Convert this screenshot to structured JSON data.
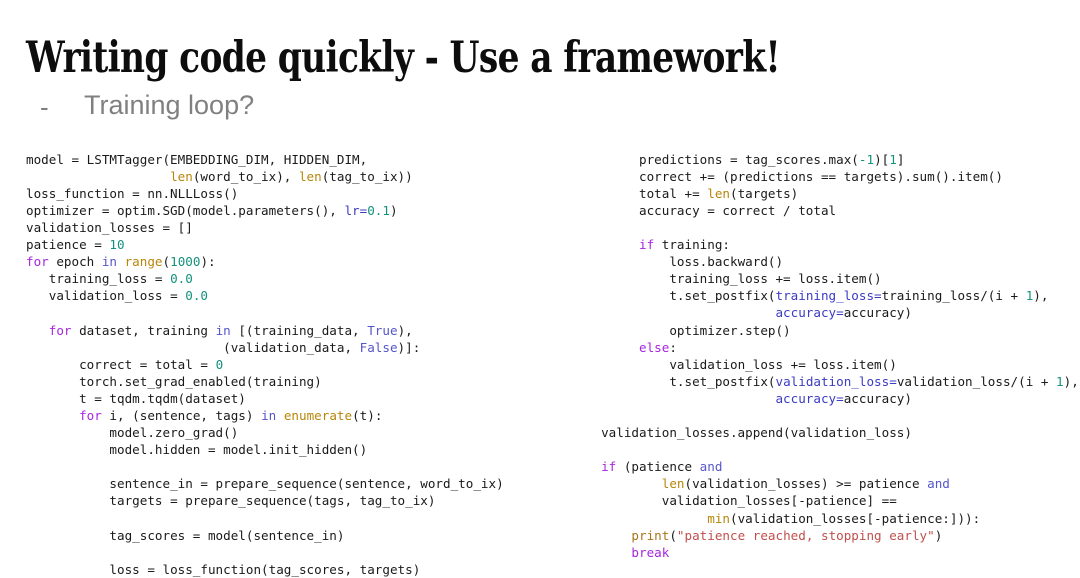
{
  "slide": {
    "title": "Writing code quickly - Use a framework!",
    "bullet_dash": "-",
    "bullet_text": "Training loop?",
    "background_color": "#ffffff",
    "title_color": "#0d0d0d",
    "bullet_color": "#808080"
  },
  "syntax_colors": {
    "keyword": "#a626e0",
    "operator_keyword": "#5555cc",
    "builtin": "#b8860b",
    "number": "#13917c",
    "kwarg": "#3b3bc4",
    "function": "#a8741a",
    "string": "#c0504d",
    "plain": "#1a1a1a"
  },
  "code_left": {
    "language": "python",
    "lines": [
      [
        {
          "t": "model = LSTMTagger(EMBEDDING_DIM, HIDDEN_DIM,",
          "c": "plain"
        }
      ],
      [
        {
          "t": "                   ",
          "c": "plain"
        },
        {
          "t": "len",
          "c": "builtin"
        },
        {
          "t": "(word_to_ix), ",
          "c": "plain"
        },
        {
          "t": "len",
          "c": "builtin"
        },
        {
          "t": "(tag_to_ix))",
          "c": "plain"
        }
      ],
      [
        {
          "t": "loss_function = nn.NLLLoss()",
          "c": "plain"
        }
      ],
      [
        {
          "t": "optimizer = optim.SGD(model.parameters(), ",
          "c": "plain"
        },
        {
          "t": "lr=",
          "c": "kwarg"
        },
        {
          "t": "0.1",
          "c": "number"
        },
        {
          "t": ")",
          "c": "plain"
        }
      ],
      [
        {
          "t": "validation_losses = []",
          "c": "plain"
        }
      ],
      [
        {
          "t": "patience = ",
          "c": "plain"
        },
        {
          "t": "10",
          "c": "number"
        }
      ],
      [
        {
          "t": "for",
          "c": "keyword"
        },
        {
          "t": " epoch ",
          "c": "plain"
        },
        {
          "t": "in",
          "c": "operator_keyword"
        },
        {
          "t": " ",
          "c": "plain"
        },
        {
          "t": "range",
          "c": "builtin"
        },
        {
          "t": "(",
          "c": "plain"
        },
        {
          "t": "1000",
          "c": "number"
        },
        {
          "t": "):",
          "c": "plain"
        }
      ],
      [
        {
          "t": "   training_loss = ",
          "c": "plain"
        },
        {
          "t": "0.0",
          "c": "number"
        }
      ],
      [
        {
          "t": "   validation_loss = ",
          "c": "plain"
        },
        {
          "t": "0.0",
          "c": "number"
        }
      ],
      [
        {
          "t": "",
          "c": "plain"
        }
      ],
      [
        {
          "t": "   ",
          "c": "plain"
        },
        {
          "t": "for",
          "c": "keyword"
        },
        {
          "t": " dataset, training ",
          "c": "plain"
        },
        {
          "t": "in",
          "c": "operator_keyword"
        },
        {
          "t": " [(training_data, ",
          "c": "plain"
        },
        {
          "t": "True",
          "c": "operator_keyword"
        },
        {
          "t": "),",
          "c": "plain"
        }
      ],
      [
        {
          "t": "                          (validation_data, ",
          "c": "plain"
        },
        {
          "t": "False",
          "c": "operator_keyword"
        },
        {
          "t": ")]:",
          "c": "plain"
        }
      ],
      [
        {
          "t": "       correct = total = ",
          "c": "plain"
        },
        {
          "t": "0",
          "c": "number"
        }
      ],
      [
        {
          "t": "       torch.set_grad_enabled(training)",
          "c": "plain"
        }
      ],
      [
        {
          "t": "       t = tqdm.tqdm(dataset)",
          "c": "plain"
        }
      ],
      [
        {
          "t": "       ",
          "c": "plain"
        },
        {
          "t": "for",
          "c": "keyword"
        },
        {
          "t": " i, (sentence, tags) ",
          "c": "plain"
        },
        {
          "t": "in",
          "c": "operator_keyword"
        },
        {
          "t": " ",
          "c": "plain"
        },
        {
          "t": "enumerate",
          "c": "builtin"
        },
        {
          "t": "(t):",
          "c": "plain"
        }
      ],
      [
        {
          "t": "           model.zero_grad()",
          "c": "plain"
        }
      ],
      [
        {
          "t": "           model.hidden = model.init_hidden()",
          "c": "plain"
        }
      ],
      [
        {
          "t": "",
          "c": "plain"
        }
      ],
      [
        {
          "t": "           sentence_in = prepare_sequence(sentence, word_to_ix)",
          "c": "plain"
        }
      ],
      [
        {
          "t": "           targets = prepare_sequence(tags, tag_to_ix)",
          "c": "plain"
        }
      ],
      [
        {
          "t": "",
          "c": "plain"
        }
      ],
      [
        {
          "t": "           tag_scores = model(sentence_in)",
          "c": "plain"
        }
      ],
      [
        {
          "t": "",
          "c": "plain"
        }
      ],
      [
        {
          "t": "           loss = loss_function(tag_scores, targets)",
          "c": "plain"
        }
      ]
    ]
  },
  "code_right": {
    "language": "python",
    "lines": [
      [
        {
          "t": "            predictions = tag_scores.max(",
          "c": "plain"
        },
        {
          "t": "-1",
          "c": "number"
        },
        {
          "t": ")[",
          "c": "plain"
        },
        {
          "t": "1",
          "c": "number"
        },
        {
          "t": "]",
          "c": "plain"
        }
      ],
      [
        {
          "t": "            correct += (predictions == targets).sum().item()",
          "c": "plain"
        }
      ],
      [
        {
          "t": "            total += ",
          "c": "plain"
        },
        {
          "t": "len",
          "c": "builtin"
        },
        {
          "t": "(targets)",
          "c": "plain"
        }
      ],
      [
        {
          "t": "            accuracy = correct / total",
          "c": "plain"
        }
      ],
      [
        {
          "t": "",
          "c": "plain"
        }
      ],
      [
        {
          "t": "            ",
          "c": "plain"
        },
        {
          "t": "if",
          "c": "keyword"
        },
        {
          "t": " training:",
          "c": "plain"
        }
      ],
      [
        {
          "t": "                loss.backward()",
          "c": "plain"
        }
      ],
      [
        {
          "t": "                training_loss += loss.item()",
          "c": "plain"
        }
      ],
      [
        {
          "t": "                t.set_postfix(",
          "c": "plain"
        },
        {
          "t": "training_loss=",
          "c": "kwarg"
        },
        {
          "t": "training_loss/(i + ",
          "c": "plain"
        },
        {
          "t": "1",
          "c": "number"
        },
        {
          "t": "),",
          "c": "plain"
        }
      ],
      [
        {
          "t": "                              ",
          "c": "plain"
        },
        {
          "t": "accuracy=",
          "c": "kwarg"
        },
        {
          "t": "accuracy)",
          "c": "plain"
        }
      ],
      [
        {
          "t": "                optimizer.step()",
          "c": "plain"
        }
      ],
      [
        {
          "t": "            ",
          "c": "plain"
        },
        {
          "t": "else",
          "c": "keyword"
        },
        {
          "t": ":",
          "c": "plain"
        }
      ],
      [
        {
          "t": "                validation_loss += loss.item()",
          "c": "plain"
        }
      ],
      [
        {
          "t": "                t.set_postfix(",
          "c": "plain"
        },
        {
          "t": "validation_loss=",
          "c": "kwarg"
        },
        {
          "t": "validation_loss/(i + ",
          "c": "plain"
        },
        {
          "t": "1",
          "c": "number"
        },
        {
          "t": "),",
          "c": "plain"
        }
      ],
      [
        {
          "t": "                              ",
          "c": "plain"
        },
        {
          "t": "accuracy=",
          "c": "kwarg"
        },
        {
          "t": "accuracy)",
          "c": "plain"
        }
      ],
      [
        {
          "t": "",
          "c": "plain"
        }
      ],
      [
        {
          "t": "       validation_losses.append(validation_loss)",
          "c": "plain"
        }
      ],
      [
        {
          "t": "",
          "c": "plain"
        }
      ],
      [
        {
          "t": "       ",
          "c": "plain"
        },
        {
          "t": "if",
          "c": "keyword"
        },
        {
          "t": " (patience ",
          "c": "plain"
        },
        {
          "t": "and",
          "c": "operator_keyword"
        }
      ],
      [
        {
          "t": "               ",
          "c": "plain"
        },
        {
          "t": "len",
          "c": "builtin"
        },
        {
          "t": "(validation_losses) >= patience ",
          "c": "plain"
        },
        {
          "t": "and",
          "c": "operator_keyword"
        }
      ],
      [
        {
          "t": "               validation_losses[-patience] ==",
          "c": "plain"
        }
      ],
      [
        {
          "t": "                     ",
          "c": "plain"
        },
        {
          "t": "min",
          "c": "builtin"
        },
        {
          "t": "(validation_losses[-patience:])):",
          "c": "plain"
        }
      ],
      [
        {
          "t": "           ",
          "c": "plain"
        },
        {
          "t": "print",
          "c": "function"
        },
        {
          "t": "(",
          "c": "plain"
        },
        {
          "t": "\"patience reached, stopping early\"",
          "c": "string"
        },
        {
          "t": ")",
          "c": "plain"
        }
      ],
      [
        {
          "t": "           ",
          "c": "plain"
        },
        {
          "t": "break",
          "c": "keyword"
        }
      ]
    ]
  }
}
